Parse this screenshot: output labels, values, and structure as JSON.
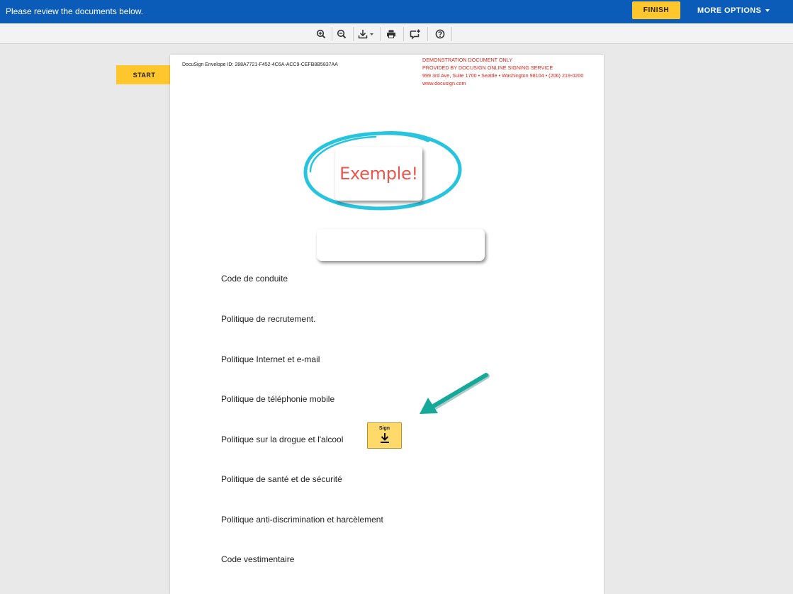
{
  "topbar": {
    "message": "Please review the documents below.",
    "finish_label": "FINISH",
    "more_options_label": "MORE OPTIONS"
  },
  "toolbar": {
    "icons": [
      "zoom-in-icon",
      "zoom-out-icon",
      "download-icon",
      "print-icon",
      "comment-icon",
      "help-icon"
    ]
  },
  "start_label": "START",
  "document": {
    "envelope_id": "DocuSign Envelope ID: 288A7721-F452-4C6A-ACC9-CEFB8B5837AA",
    "demo_lines": [
      "DEMONSTRATION DOCUMENT ONLY",
      "PROVIDED BY DOCUSIGN ONLINE SIGNING SERVICE",
      "999 3rd Ave, Suite 1700  • Seattle • Washington 98104 • (206) 219-0200",
      "www.docusign.com"
    ],
    "exemple_text": "Exemple!",
    "policies": [
      "Code de conduite",
      "Politique de recrutement.",
      "Politique Internet et e-mail",
      "Politique de téléphonie mobile",
      "Politique sur la drogue et l'alcool",
      "Politique de santé et de sécurité",
      "Politique anti-discrimination et harcèlement",
      "Code vestimentaire"
    ],
    "sign_label": "Sign"
  },
  "colors": {
    "topbar": "#0a5cb8",
    "accent_yellow": "#ffc72c",
    "demo_red": "#e2231a",
    "circle_cyan": "#27c4dd",
    "arrow_teal": "#16a99a"
  }
}
